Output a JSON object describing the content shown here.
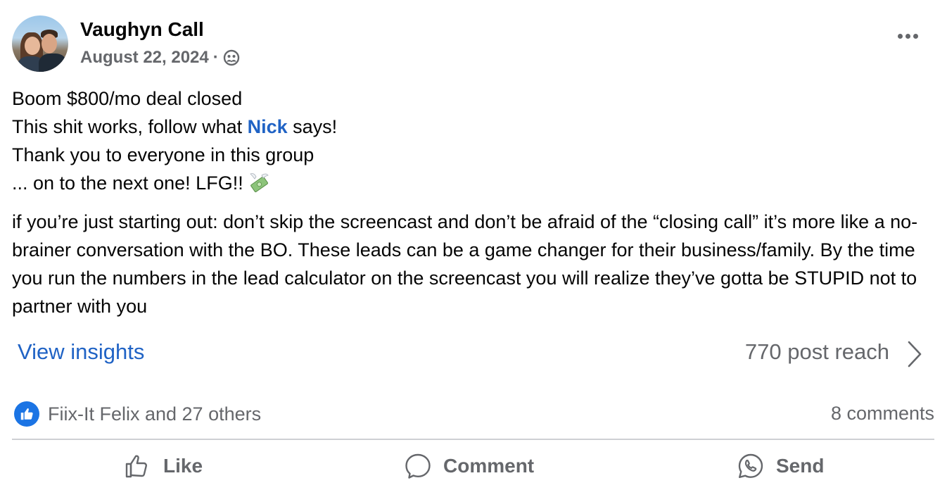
{
  "post": {
    "author": "Vaughyn Call",
    "date": "August 22, 2024",
    "separator": "·",
    "privacy_icon": "group-icon",
    "lines": [
      "Boom $800/mo deal closed",
      "This shit works, follow what ",
      "Nick",
      " says!",
      "Thank you to everyone in this group",
      "... on to the next one! LFG!!"
    ],
    "emoji": "money-with-wings",
    "paragraph": "if you’re just starting out: don’t skip the screencast and don’t be afraid of the “closing call” it’s more like a no-brainer conversation with the BO. These leads can be a game changer for their business/family. By the time you run the numbers in the lead calculator on the screencast you will realize they’ve gotta be STUPID not to partner with you"
  },
  "insights": {
    "link_label": "View insights",
    "reach": "770 post reach"
  },
  "engagement": {
    "reactions": "Fiix-It Felix and 27 others",
    "comments": "8 comments"
  },
  "actions": {
    "like": "Like",
    "comment": "Comment",
    "send": "Send"
  },
  "colors": {
    "link_blue": "#2063c5",
    "muted_gray": "#65676b",
    "like_blue": "#1b74e4",
    "divider": "#ced0d4"
  }
}
